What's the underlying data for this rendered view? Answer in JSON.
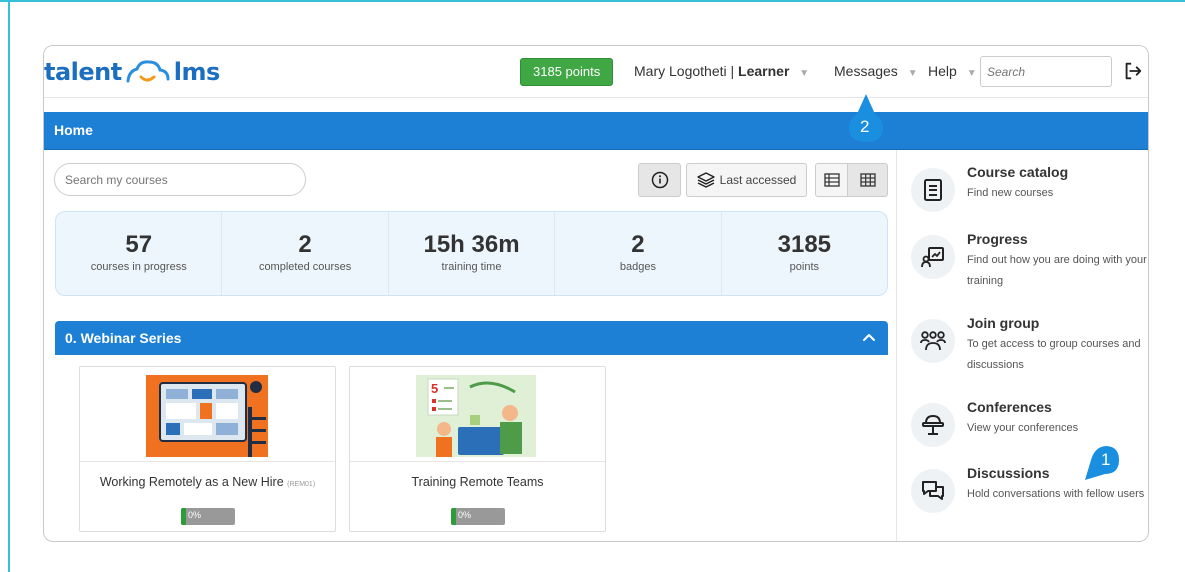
{
  "header": {
    "logo_text_left": "talent",
    "logo_text_right": "lms",
    "points": "3185 points",
    "user_name": "Mary Logotheti",
    "user_role": "Learner",
    "messages": "Messages",
    "help": "Help",
    "search_placeholder": "Search"
  },
  "home": {
    "title": "Home"
  },
  "toolbar": {
    "course_search_placeholder": "Search my courses",
    "sort_label": "Last accessed"
  },
  "stats": [
    {
      "value": "57",
      "label": "courses in progress"
    },
    {
      "value": "2",
      "label": "completed courses"
    },
    {
      "value": "15h 36m",
      "label": "training time"
    },
    {
      "value": "2",
      "label": "badges"
    },
    {
      "value": "3185",
      "label": "points"
    }
  ],
  "category": {
    "title": "0. Webinar Series"
  },
  "courses": [
    {
      "title": "Working Remotely as a New Hire",
      "code": "(REM01)",
      "progress_label": "0%",
      "progress": 0
    },
    {
      "title": "Training Remote Teams",
      "code": "",
      "progress_label": "0%",
      "progress": 0
    }
  ],
  "sidebar": {
    "items": [
      {
        "title": "Course catalog",
        "desc": "Find new courses",
        "icon": "book-icon"
      },
      {
        "title": "Progress",
        "desc": "Find out how you are doing with your training",
        "icon": "progress-chart-icon"
      },
      {
        "title": "Join group",
        "desc": "To get access to group courses and discussions",
        "icon": "group-icon"
      },
      {
        "title": "Conferences",
        "desc": "View your conferences",
        "icon": "conference-icon"
      },
      {
        "title": "Discussions",
        "desc": "Hold conversations with fellow users",
        "icon": "discussion-icon"
      }
    ]
  },
  "callouts": [
    "1",
    "2"
  ],
  "colors": {
    "accent_blue": "#1e80d4",
    "points_green": "#3fa844",
    "callout_blue": "#1a8fe0",
    "frame_cyan": "#36c0d8"
  }
}
